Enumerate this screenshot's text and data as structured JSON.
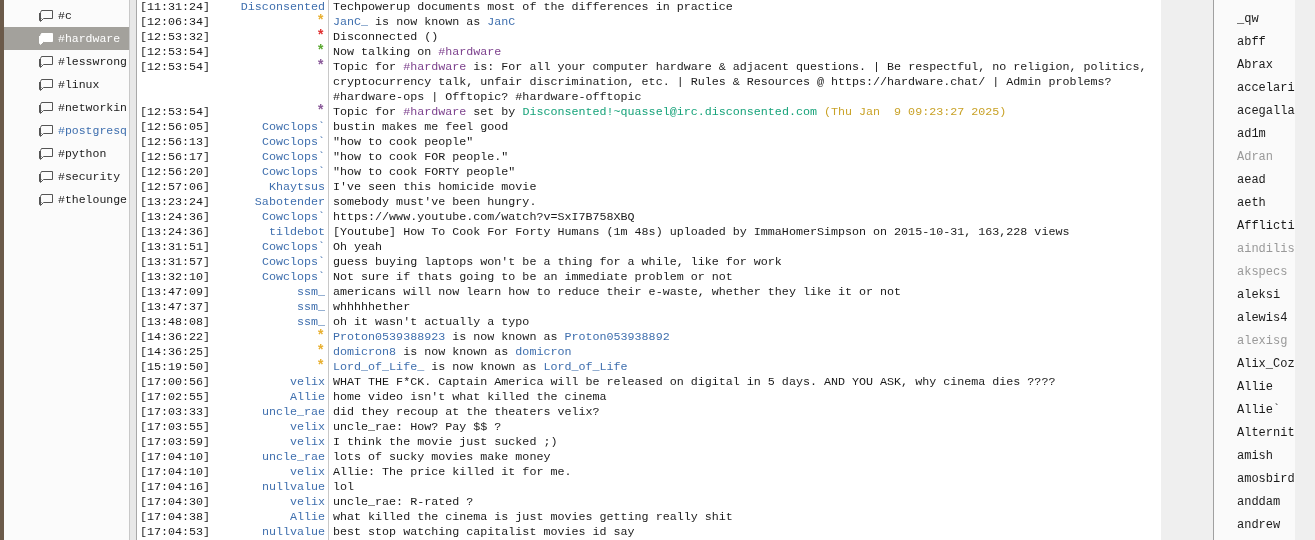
{
  "channels": [
    {
      "name": "#c",
      "selected": false,
      "activity": false
    },
    {
      "name": "#hardware",
      "selected": true,
      "activity": false
    },
    {
      "name": "#lesswrong",
      "selected": false,
      "activity": false
    },
    {
      "name": "#linux",
      "selected": false,
      "activity": false
    },
    {
      "name": "#networkin",
      "selected": false,
      "activity": false
    },
    {
      "name": "#postgresq",
      "selected": false,
      "activity": true
    },
    {
      "name": "#python",
      "selected": false,
      "activity": false
    },
    {
      "name": "#security",
      "selected": false,
      "activity": false
    },
    {
      "name": "#thelounge",
      "selected": false,
      "activity": false
    }
  ],
  "messages": [
    {
      "time": "[11:31:24]",
      "kind": "message",
      "nick": "Disconsented",
      "parts": [
        {
          "kind": "text",
          "text": "Techpowerup documents most of the differences in practice"
        }
      ]
    },
    {
      "time": "[12:06:34]",
      "kind": "event",
      "nick": "*",
      "color": "#e8b030",
      "parts": [
        {
          "kind": "nick",
          "text": "JanC_"
        },
        {
          "kind": "text",
          "text": " is now known as "
        },
        {
          "kind": "nick",
          "text": "JanC"
        }
      ]
    },
    {
      "time": "[12:53:32]",
      "kind": "event",
      "nick": "*",
      "color": "#e03030",
      "parts": [
        {
          "kind": "text",
          "text": "Disconnected ()"
        }
      ]
    },
    {
      "time": "[12:53:54]",
      "kind": "event",
      "nick": "*",
      "color": "#5aa830",
      "parts": [
        {
          "kind": "text",
          "text": "Now talking on "
        },
        {
          "kind": "channel",
          "text": "#hardware"
        }
      ]
    },
    {
      "time": "[12:53:54]",
      "kind": "event",
      "nick": "*",
      "color": "#8a5a9a",
      "parts": [
        {
          "kind": "text",
          "text": "Topic for "
        },
        {
          "kind": "channel",
          "text": "#hardware"
        },
        {
          "kind": "text",
          "text": " is: For all your computer hardware & adjacent questions. | Be respectful, no religion, politics, cryptocurrency talk, unfair discrimination, etc. | Rules & Resources @ https://hardware.chat/ | Admin problems? #hardware-ops | Offtopic? #hardware-offtopic"
        }
      ]
    },
    {
      "time": "[12:53:54]",
      "kind": "event",
      "nick": "*",
      "color": "#8a5a9a",
      "parts": [
        {
          "kind": "text",
          "text": "Topic for "
        },
        {
          "kind": "channel",
          "text": "#hardware"
        },
        {
          "kind": "text",
          "text": " set by "
        },
        {
          "kind": "host",
          "text": "Disconsented!~quassel@irc.disconsented.com"
        },
        {
          "kind": "date",
          "text": "(Thu Jan  9 09:23:27 2025)"
        }
      ]
    },
    {
      "time": "[12:56:05]",
      "kind": "message",
      "nick": "Cowclops`",
      "parts": [
        {
          "kind": "text",
          "text": "bustin makes me feel good"
        }
      ]
    },
    {
      "time": "[12:56:13]",
      "kind": "message",
      "nick": "Cowclops`",
      "parts": [
        {
          "kind": "text",
          "text": "\"how to cook people\""
        }
      ]
    },
    {
      "time": "[12:56:17]",
      "kind": "message",
      "nick": "Cowclops`",
      "parts": [
        {
          "kind": "text",
          "text": "\"how to cook FOR people.\""
        }
      ]
    },
    {
      "time": "[12:56:20]",
      "kind": "message",
      "nick": "Cowclops`",
      "parts": [
        {
          "kind": "text",
          "text": "\"how to cook FORTY people\""
        }
      ]
    },
    {
      "time": "[12:57:06]",
      "kind": "message",
      "nick": "Khaytsus",
      "parts": [
        {
          "kind": "text",
          "text": "I've seen this homicide movie"
        }
      ]
    },
    {
      "time": "[13:23:24]",
      "kind": "message",
      "nick": "Sabotender",
      "parts": [
        {
          "kind": "text",
          "text": "somebody must've been hungry."
        }
      ]
    },
    {
      "time": "[13:24:36]",
      "kind": "message",
      "nick": "Cowclops`",
      "parts": [
        {
          "kind": "text",
          "text": "https://www.youtube.com/watch?v=SxI7B758XBQ"
        }
      ]
    },
    {
      "time": "[13:24:36]",
      "kind": "message",
      "nick": "tildebot",
      "parts": [
        {
          "kind": "text",
          "text": "[Youtube] How To Cook For Forty Humans (1m 48s) uploaded by ImmaHomerSimpson on 2015-10-31, 163,228 views"
        }
      ]
    },
    {
      "time": "[13:31:51]",
      "kind": "message",
      "nick": "Cowclops`",
      "parts": [
        {
          "kind": "text",
          "text": "Oh yeah"
        }
      ]
    },
    {
      "time": "[13:31:57]",
      "kind": "message",
      "nick": "Cowclops`",
      "parts": [
        {
          "kind": "text",
          "text": "guess buying laptops won't be a thing for a while, like for work"
        }
      ]
    },
    {
      "time": "[13:32:10]",
      "kind": "message",
      "nick": "Cowclops`",
      "parts": [
        {
          "kind": "text",
          "text": "Not sure if thats going to be an immediate problem or not"
        }
      ]
    },
    {
      "time": "[13:47:09]",
      "kind": "message",
      "nick": "ssm_",
      "parts": [
        {
          "kind": "text",
          "text": "americans will now learn how to reduce their e-waste, whether they like it or not"
        }
      ]
    },
    {
      "time": "[13:47:37]",
      "kind": "message",
      "nick": "ssm_",
      "parts": [
        {
          "kind": "text",
          "text": "whhhhhether"
        }
      ]
    },
    {
      "time": "[13:48:08]",
      "kind": "message",
      "nick": "ssm_",
      "parts": [
        {
          "kind": "text",
          "text": "oh it wasn't actually a typo"
        }
      ]
    },
    {
      "time": "[14:36:22]",
      "kind": "event",
      "nick": "*",
      "color": "#e8b030",
      "parts": [
        {
          "kind": "nick",
          "text": "Proton0539388923"
        },
        {
          "kind": "text",
          "text": " is now known as "
        },
        {
          "kind": "nick",
          "text": "Proton053938892"
        }
      ]
    },
    {
      "time": "[14:36:25]",
      "kind": "event",
      "nick": "*",
      "color": "#e8b030",
      "parts": [
        {
          "kind": "nick",
          "text": "domicron8"
        },
        {
          "kind": "text",
          "text": " is now known as "
        },
        {
          "kind": "nick",
          "text": "domicron"
        }
      ]
    },
    {
      "time": "[15:19:50]",
      "kind": "event",
      "nick": "*",
      "color": "#e8b030",
      "parts": [
        {
          "kind": "nick",
          "text": "Lord_of_Life_"
        },
        {
          "kind": "text",
          "text": " is now known as "
        },
        {
          "kind": "nick",
          "text": "Lord_of_Life"
        }
      ]
    },
    {
      "time": "[17:00:56]",
      "kind": "message",
      "nick": "velix",
      "parts": [
        {
          "kind": "text",
          "text": "WHAT THE F*CK. Captain America will be released on digital in 5 days. AND YOU ASK, why cinema dies ????"
        }
      ]
    },
    {
      "time": "[17:02:55]",
      "kind": "message",
      "nick": "Allie",
      "parts": [
        {
          "kind": "text",
          "text": "home video isn't what killed the cinema"
        }
      ]
    },
    {
      "time": "[17:03:33]",
      "kind": "message",
      "nick": "uncle_rae",
      "parts": [
        {
          "kind": "text",
          "text": "did they recoup at the theaters velix?"
        }
      ]
    },
    {
      "time": "[17:03:55]",
      "kind": "message",
      "nick": "velix",
      "parts": [
        {
          "kind": "text",
          "text": "uncle_rae: How? Pay $$ ?"
        }
      ]
    },
    {
      "time": "[17:03:59]",
      "kind": "message",
      "nick": "velix",
      "parts": [
        {
          "kind": "text",
          "text": "I think the movie just sucked ;)"
        }
      ]
    },
    {
      "time": "[17:04:10]",
      "kind": "message",
      "nick": "uncle_rae",
      "parts": [
        {
          "kind": "text",
          "text": "lots of sucky movies make money"
        }
      ]
    },
    {
      "time": "[17:04:10]",
      "kind": "message",
      "nick": "velix",
      "parts": [
        {
          "kind": "text",
          "text": "Allie: The price killed it for me."
        }
      ]
    },
    {
      "time": "[17:04:16]",
      "kind": "message",
      "nick": "nullvalue",
      "parts": [
        {
          "kind": "text",
          "text": "lol"
        }
      ]
    },
    {
      "time": "[17:04:30]",
      "kind": "message",
      "nick": "velix",
      "parts": [
        {
          "kind": "text",
          "text": "uncle_rae: R-rated ?"
        }
      ]
    },
    {
      "time": "[17:04:38]",
      "kind": "message",
      "nick": "Allie",
      "parts": [
        {
          "kind": "text",
          "text": "what killed the cinema is just movies getting really shit"
        }
      ]
    },
    {
      "time": "[17:04:53]",
      "kind": "message",
      "nick": "nullvalue",
      "parts": [
        {
          "kind": "text",
          "text": "best stop watching capitalist movies id say"
        }
      ]
    }
  ],
  "users": [
    {
      "name": "_qw",
      "away": false
    },
    {
      "name": "abff",
      "away": false
    },
    {
      "name": "Abrax",
      "away": false
    },
    {
      "name": "accelari",
      "away": false
    },
    {
      "name": "acegalla",
      "away": false
    },
    {
      "name": "ad1m",
      "away": false
    },
    {
      "name": "Adran",
      "away": true
    },
    {
      "name": "aead",
      "away": false
    },
    {
      "name": "aeth",
      "away": false
    },
    {
      "name": "Afflicti",
      "away": false
    },
    {
      "name": "aindilis",
      "away": true
    },
    {
      "name": "akspecs",
      "away": true
    },
    {
      "name": "aleksi",
      "away": false
    },
    {
      "name": "alewis4",
      "away": false
    },
    {
      "name": "alexisg",
      "away": true
    },
    {
      "name": "Alix_Coz",
      "away": false
    },
    {
      "name": "Allie",
      "away": false
    },
    {
      "name": "Allie`",
      "away": false
    },
    {
      "name": "Alternit",
      "away": false
    },
    {
      "name": "amish",
      "away": false
    },
    {
      "name": "amosbird",
      "away": false
    },
    {
      "name": "anddam",
      "away": false
    },
    {
      "name": "andrew",
      "away": false
    }
  ]
}
